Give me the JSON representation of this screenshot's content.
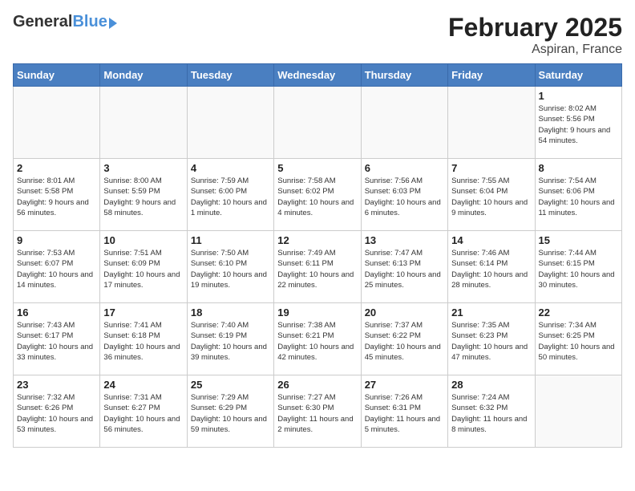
{
  "header": {
    "logo_general": "General",
    "logo_blue": "Blue",
    "main_title": "February 2025",
    "subtitle": "Aspiran, France"
  },
  "days_of_week": [
    "Sunday",
    "Monday",
    "Tuesday",
    "Wednesday",
    "Thursday",
    "Friday",
    "Saturday"
  ],
  "weeks": [
    [
      {
        "day": "",
        "info": ""
      },
      {
        "day": "",
        "info": ""
      },
      {
        "day": "",
        "info": ""
      },
      {
        "day": "",
        "info": ""
      },
      {
        "day": "",
        "info": ""
      },
      {
        "day": "",
        "info": ""
      },
      {
        "day": "1",
        "info": "Sunrise: 8:02 AM\nSunset: 5:56 PM\nDaylight: 9 hours and 54 minutes."
      }
    ],
    [
      {
        "day": "2",
        "info": "Sunrise: 8:01 AM\nSunset: 5:58 PM\nDaylight: 9 hours and 56 minutes."
      },
      {
        "day": "3",
        "info": "Sunrise: 8:00 AM\nSunset: 5:59 PM\nDaylight: 9 hours and 58 minutes."
      },
      {
        "day": "4",
        "info": "Sunrise: 7:59 AM\nSunset: 6:00 PM\nDaylight: 10 hours and 1 minute."
      },
      {
        "day": "5",
        "info": "Sunrise: 7:58 AM\nSunset: 6:02 PM\nDaylight: 10 hours and 4 minutes."
      },
      {
        "day": "6",
        "info": "Sunrise: 7:56 AM\nSunset: 6:03 PM\nDaylight: 10 hours and 6 minutes."
      },
      {
        "day": "7",
        "info": "Sunrise: 7:55 AM\nSunset: 6:04 PM\nDaylight: 10 hours and 9 minutes."
      },
      {
        "day": "8",
        "info": "Sunrise: 7:54 AM\nSunset: 6:06 PM\nDaylight: 10 hours and 11 minutes."
      }
    ],
    [
      {
        "day": "9",
        "info": "Sunrise: 7:53 AM\nSunset: 6:07 PM\nDaylight: 10 hours and 14 minutes."
      },
      {
        "day": "10",
        "info": "Sunrise: 7:51 AM\nSunset: 6:09 PM\nDaylight: 10 hours and 17 minutes."
      },
      {
        "day": "11",
        "info": "Sunrise: 7:50 AM\nSunset: 6:10 PM\nDaylight: 10 hours and 19 minutes."
      },
      {
        "day": "12",
        "info": "Sunrise: 7:49 AM\nSunset: 6:11 PM\nDaylight: 10 hours and 22 minutes."
      },
      {
        "day": "13",
        "info": "Sunrise: 7:47 AM\nSunset: 6:13 PM\nDaylight: 10 hours and 25 minutes."
      },
      {
        "day": "14",
        "info": "Sunrise: 7:46 AM\nSunset: 6:14 PM\nDaylight: 10 hours and 28 minutes."
      },
      {
        "day": "15",
        "info": "Sunrise: 7:44 AM\nSunset: 6:15 PM\nDaylight: 10 hours and 30 minutes."
      }
    ],
    [
      {
        "day": "16",
        "info": "Sunrise: 7:43 AM\nSunset: 6:17 PM\nDaylight: 10 hours and 33 minutes."
      },
      {
        "day": "17",
        "info": "Sunrise: 7:41 AM\nSunset: 6:18 PM\nDaylight: 10 hours and 36 minutes."
      },
      {
        "day": "18",
        "info": "Sunrise: 7:40 AM\nSunset: 6:19 PM\nDaylight: 10 hours and 39 minutes."
      },
      {
        "day": "19",
        "info": "Sunrise: 7:38 AM\nSunset: 6:21 PM\nDaylight: 10 hours and 42 minutes."
      },
      {
        "day": "20",
        "info": "Sunrise: 7:37 AM\nSunset: 6:22 PM\nDaylight: 10 hours and 45 minutes."
      },
      {
        "day": "21",
        "info": "Sunrise: 7:35 AM\nSunset: 6:23 PM\nDaylight: 10 hours and 47 minutes."
      },
      {
        "day": "22",
        "info": "Sunrise: 7:34 AM\nSunset: 6:25 PM\nDaylight: 10 hours and 50 minutes."
      }
    ],
    [
      {
        "day": "23",
        "info": "Sunrise: 7:32 AM\nSunset: 6:26 PM\nDaylight: 10 hours and 53 minutes."
      },
      {
        "day": "24",
        "info": "Sunrise: 7:31 AM\nSunset: 6:27 PM\nDaylight: 10 hours and 56 minutes."
      },
      {
        "day": "25",
        "info": "Sunrise: 7:29 AM\nSunset: 6:29 PM\nDaylight: 10 hours and 59 minutes."
      },
      {
        "day": "26",
        "info": "Sunrise: 7:27 AM\nSunset: 6:30 PM\nDaylight: 11 hours and 2 minutes."
      },
      {
        "day": "27",
        "info": "Sunrise: 7:26 AM\nSunset: 6:31 PM\nDaylight: 11 hours and 5 minutes."
      },
      {
        "day": "28",
        "info": "Sunrise: 7:24 AM\nSunset: 6:32 PM\nDaylight: 11 hours and 8 minutes."
      },
      {
        "day": "",
        "info": ""
      }
    ]
  ]
}
